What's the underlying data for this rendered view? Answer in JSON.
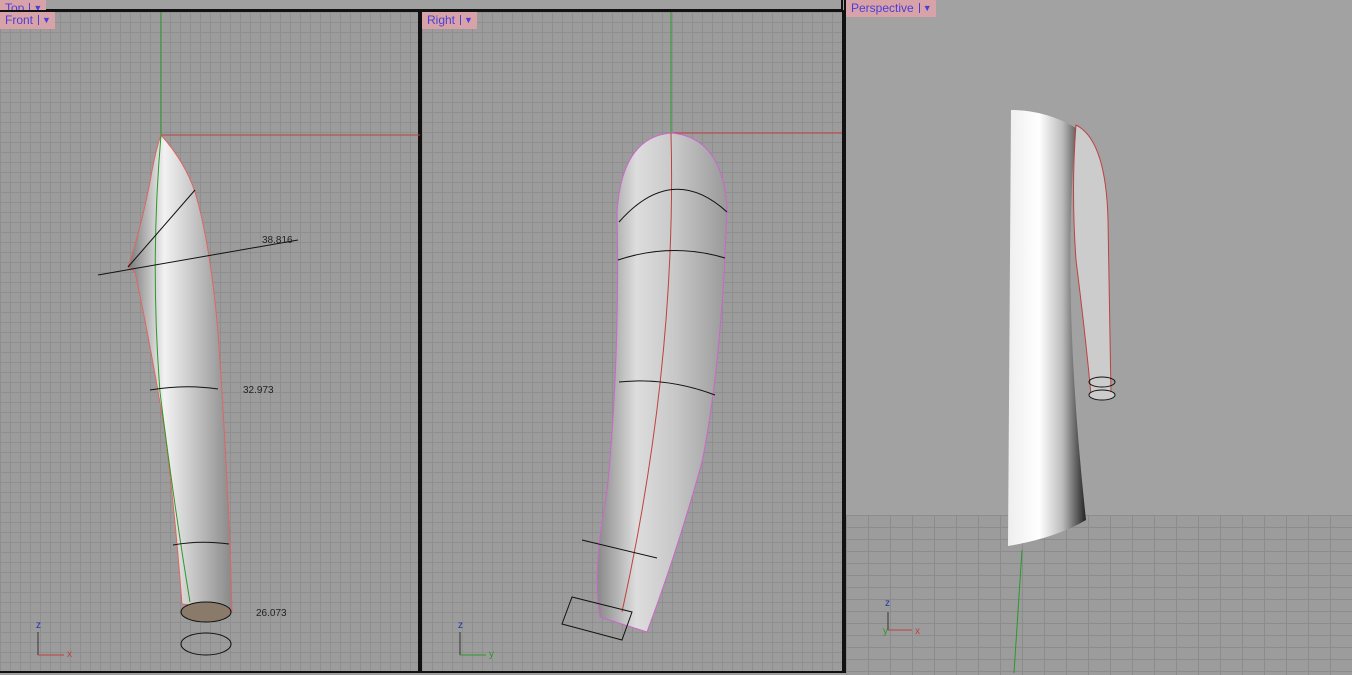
{
  "viewports": {
    "top": {
      "label": "Top"
    },
    "front": {
      "label": "Front",
      "dimensions": [
        "38.816",
        "32.973",
        "26.073"
      ],
      "axis": {
        "up": "z",
        "right": "x"
      }
    },
    "right": {
      "label": "Right",
      "axis": {
        "up": "z",
        "right": "y"
      }
    },
    "perspective": {
      "label": "Perspective",
      "axis": {
        "up": "z",
        "right": "x",
        "depth": "y"
      }
    }
  },
  "icons": {
    "dropdown": "triangle-down-icon"
  },
  "colors": {
    "label_bg": "#d7a3a9",
    "label_text": "#4a3fd6",
    "x_axis": "#c04040",
    "y_axis": "#2a9a2a"
  }
}
